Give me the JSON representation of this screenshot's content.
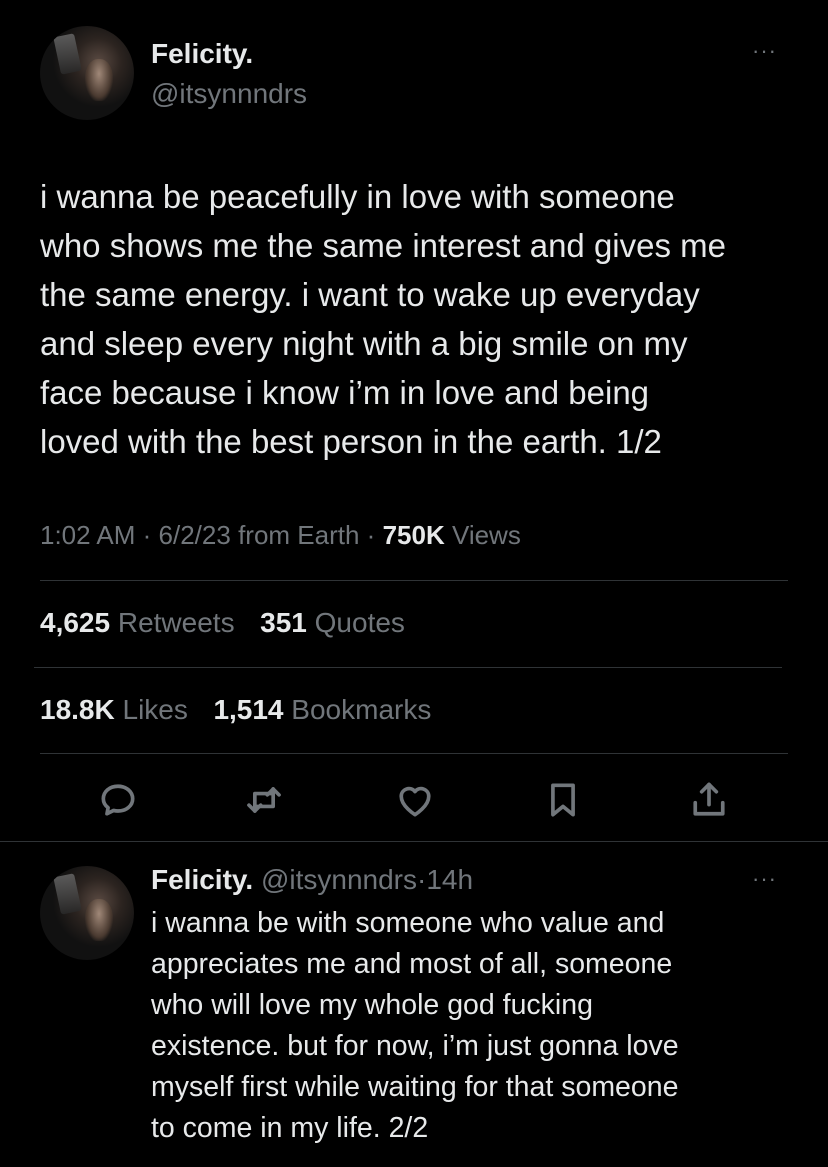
{
  "main_tweet": {
    "display_name": "Felicity.",
    "handle": "@itsynnndrs",
    "more_label": "···",
    "text": "i wanna be peacefully in love with someone\nwho shows me the same interest and gives me\nthe same energy. i want to wake up everyday\nand sleep every night with a big smile on my\nface because i know i’m in love and being\nloved with the best person in the earth. 1/2",
    "time": "1:02 AM",
    "date": "6/2/23",
    "source": "from Earth",
    "views_count": "750K",
    "views_label": "Views",
    "stats": {
      "retweets_count": "4,625",
      "retweets_label": "Retweets",
      "quotes_count": "351",
      "quotes_label": "Quotes",
      "likes_count": "18.8K",
      "likes_label": "Likes",
      "bookmarks_count": "1,514",
      "bookmarks_label": "Bookmarks"
    },
    "actions": [
      "reply-icon",
      "retweet-icon",
      "like-icon",
      "bookmark-icon",
      "share-icon"
    ]
  },
  "reply_tweet": {
    "display_name": "Felicity.",
    "handle": "@itsynnndrs",
    "separator": "·",
    "time_ago": "14h",
    "more_label": "···",
    "text": "i wanna be with someone who value and\nappreciates me and most of all, someone\nwho will love my whole god fucking\nexistence. but for now, i’m just gonna love\nmyself first while waiting for that someone\nto come in my life. 2/2"
  },
  "colors": {
    "background": "#000000",
    "text": "#e7e9ea",
    "muted": "#71767b",
    "divider": "#2f3336"
  }
}
